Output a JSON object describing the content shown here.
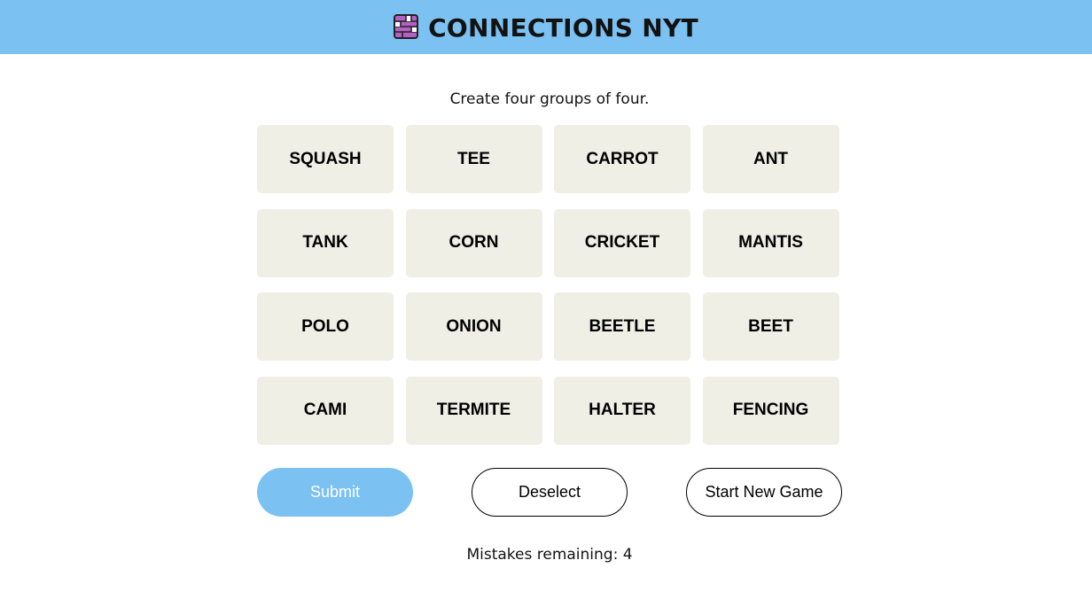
{
  "header": {
    "title": "CONNECTIONS NYT",
    "icon": "connections-grid-icon",
    "background_color": "#7bc1f2"
  },
  "instructions": "Create four groups of four.",
  "tiles": [
    "SQUASH",
    "TEE",
    "CARROT",
    "ANT",
    "TANK",
    "CORN",
    "CRICKET",
    "MANTIS",
    "POLO",
    "ONION",
    "BEETLE",
    "BEET",
    "CAMI",
    "TERMITE",
    "HALTER",
    "FENCING"
  ],
  "tile_color": "#efefe6",
  "buttons": {
    "submit_label": "Submit",
    "deselect_label": "Deselect",
    "new_game_label": "Start New Game"
  },
  "status": {
    "mistakes_text": "Mistakes remaining: 4"
  }
}
